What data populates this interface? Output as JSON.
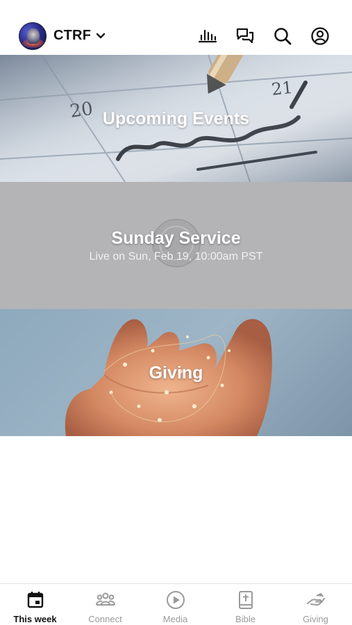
{
  "header": {
    "brand": "CTRF"
  },
  "cards": [
    {
      "title": "Upcoming Events"
    },
    {
      "title": "Sunday Service",
      "subtitle": "Live on Sun, Feb 19, 10:00am PST"
    },
    {
      "title": "Giving"
    }
  ],
  "tabbar": {
    "items": [
      {
        "label": "This week",
        "icon": "calendar-icon",
        "active": true
      },
      {
        "label": "Connect",
        "icon": "people-icon",
        "active": false
      },
      {
        "label": "Media",
        "icon": "play-icon",
        "active": false
      },
      {
        "label": "Bible",
        "icon": "bible-icon",
        "active": false
      },
      {
        "label": "Giving",
        "icon": "giving-hand-icon",
        "active": false
      }
    ]
  },
  "colors": {
    "active_tab": "#111111",
    "inactive_tab": "#9a9a9a",
    "service_card_bg": "#b4b4b6"
  }
}
